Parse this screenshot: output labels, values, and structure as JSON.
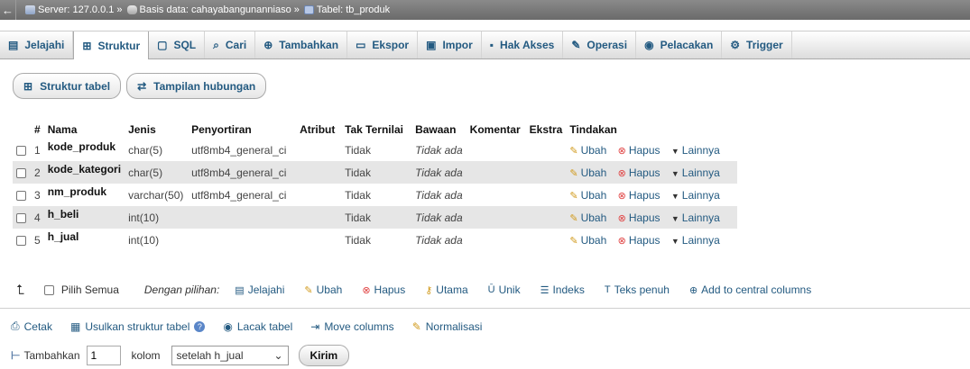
{
  "breadcrumb": {
    "back": "←",
    "server": "Server: 127.0.0.1",
    "database": "Basis data: cahayabangunanniaso",
    "table": "Tabel: tb_produk",
    "separator": "»"
  },
  "tabs": [
    {
      "label": "Jelajahi",
      "icon": "browse-icon"
    },
    {
      "label": "Struktur",
      "icon": "structure-icon"
    },
    {
      "label": "SQL",
      "icon": "sql-icon"
    },
    {
      "label": "Cari",
      "icon": "search-icon"
    },
    {
      "label": "Tambahkan",
      "icon": "insert-icon"
    },
    {
      "label": "Ekspor",
      "icon": "export-icon"
    },
    {
      "label": "Impor",
      "icon": "import-icon"
    },
    {
      "label": "Hak Akses",
      "icon": "privileges-icon"
    },
    {
      "label": "Operasi",
      "icon": "operations-icon"
    },
    {
      "label": "Pelacakan",
      "icon": "tracking-icon"
    },
    {
      "label": "Trigger",
      "icon": "trigger-icon"
    }
  ],
  "subtabs": {
    "structure": "Struktur tabel",
    "relations": "Tampilan hubungan"
  },
  "table": {
    "headers": [
      "#",
      "Nama",
      "Jenis",
      "Penyortiran",
      "Atribut",
      "Tak Ternilai",
      "Bawaan",
      "Komentar",
      "Ekstra",
      "Tindakan"
    ],
    "rows": [
      {
        "no": "1",
        "name": "kode_produk",
        "type": "char(5)",
        "collation": "utf8mb4_general_ci",
        "null": "Tidak",
        "default": "Tidak ada"
      },
      {
        "no": "2",
        "name": "kode_kategori",
        "type": "char(5)",
        "collation": "utf8mb4_general_ci",
        "null": "Tidak",
        "default": "Tidak ada"
      },
      {
        "no": "3",
        "name": "nm_produk",
        "type": "varchar(50)",
        "collation": "utf8mb4_general_ci",
        "null": "Tidak",
        "default": "Tidak ada"
      },
      {
        "no": "4",
        "name": "h_beli",
        "type": "int(10)",
        "collation": "",
        "null": "Tidak",
        "default": "Tidak ada"
      },
      {
        "no": "5",
        "name": "h_jual",
        "type": "int(10)",
        "collation": "",
        "null": "Tidak",
        "default": "Tidak ada"
      }
    ],
    "actions": {
      "edit": "Ubah",
      "delete": "Hapus",
      "more": "Lainnya"
    }
  },
  "bulk": {
    "check_all": "Pilih Semua",
    "with_selected": "Dengan pilihan:",
    "items": [
      "Jelajahi",
      "Ubah",
      "Hapus",
      "Utama",
      "Unik",
      "Indeks",
      "Teks penuh",
      "Add to central columns"
    ]
  },
  "print_bar": {
    "print": "Cetak",
    "propose": "Usulkan struktur tabel",
    "track": "Lacak tabel",
    "move": "Move columns",
    "normalize": "Normalisasi"
  },
  "add_bar": {
    "label": "Tambahkan",
    "count": "1",
    "unit": "kolom",
    "position": "setelah h_jual",
    "submit": "Kirim"
  }
}
